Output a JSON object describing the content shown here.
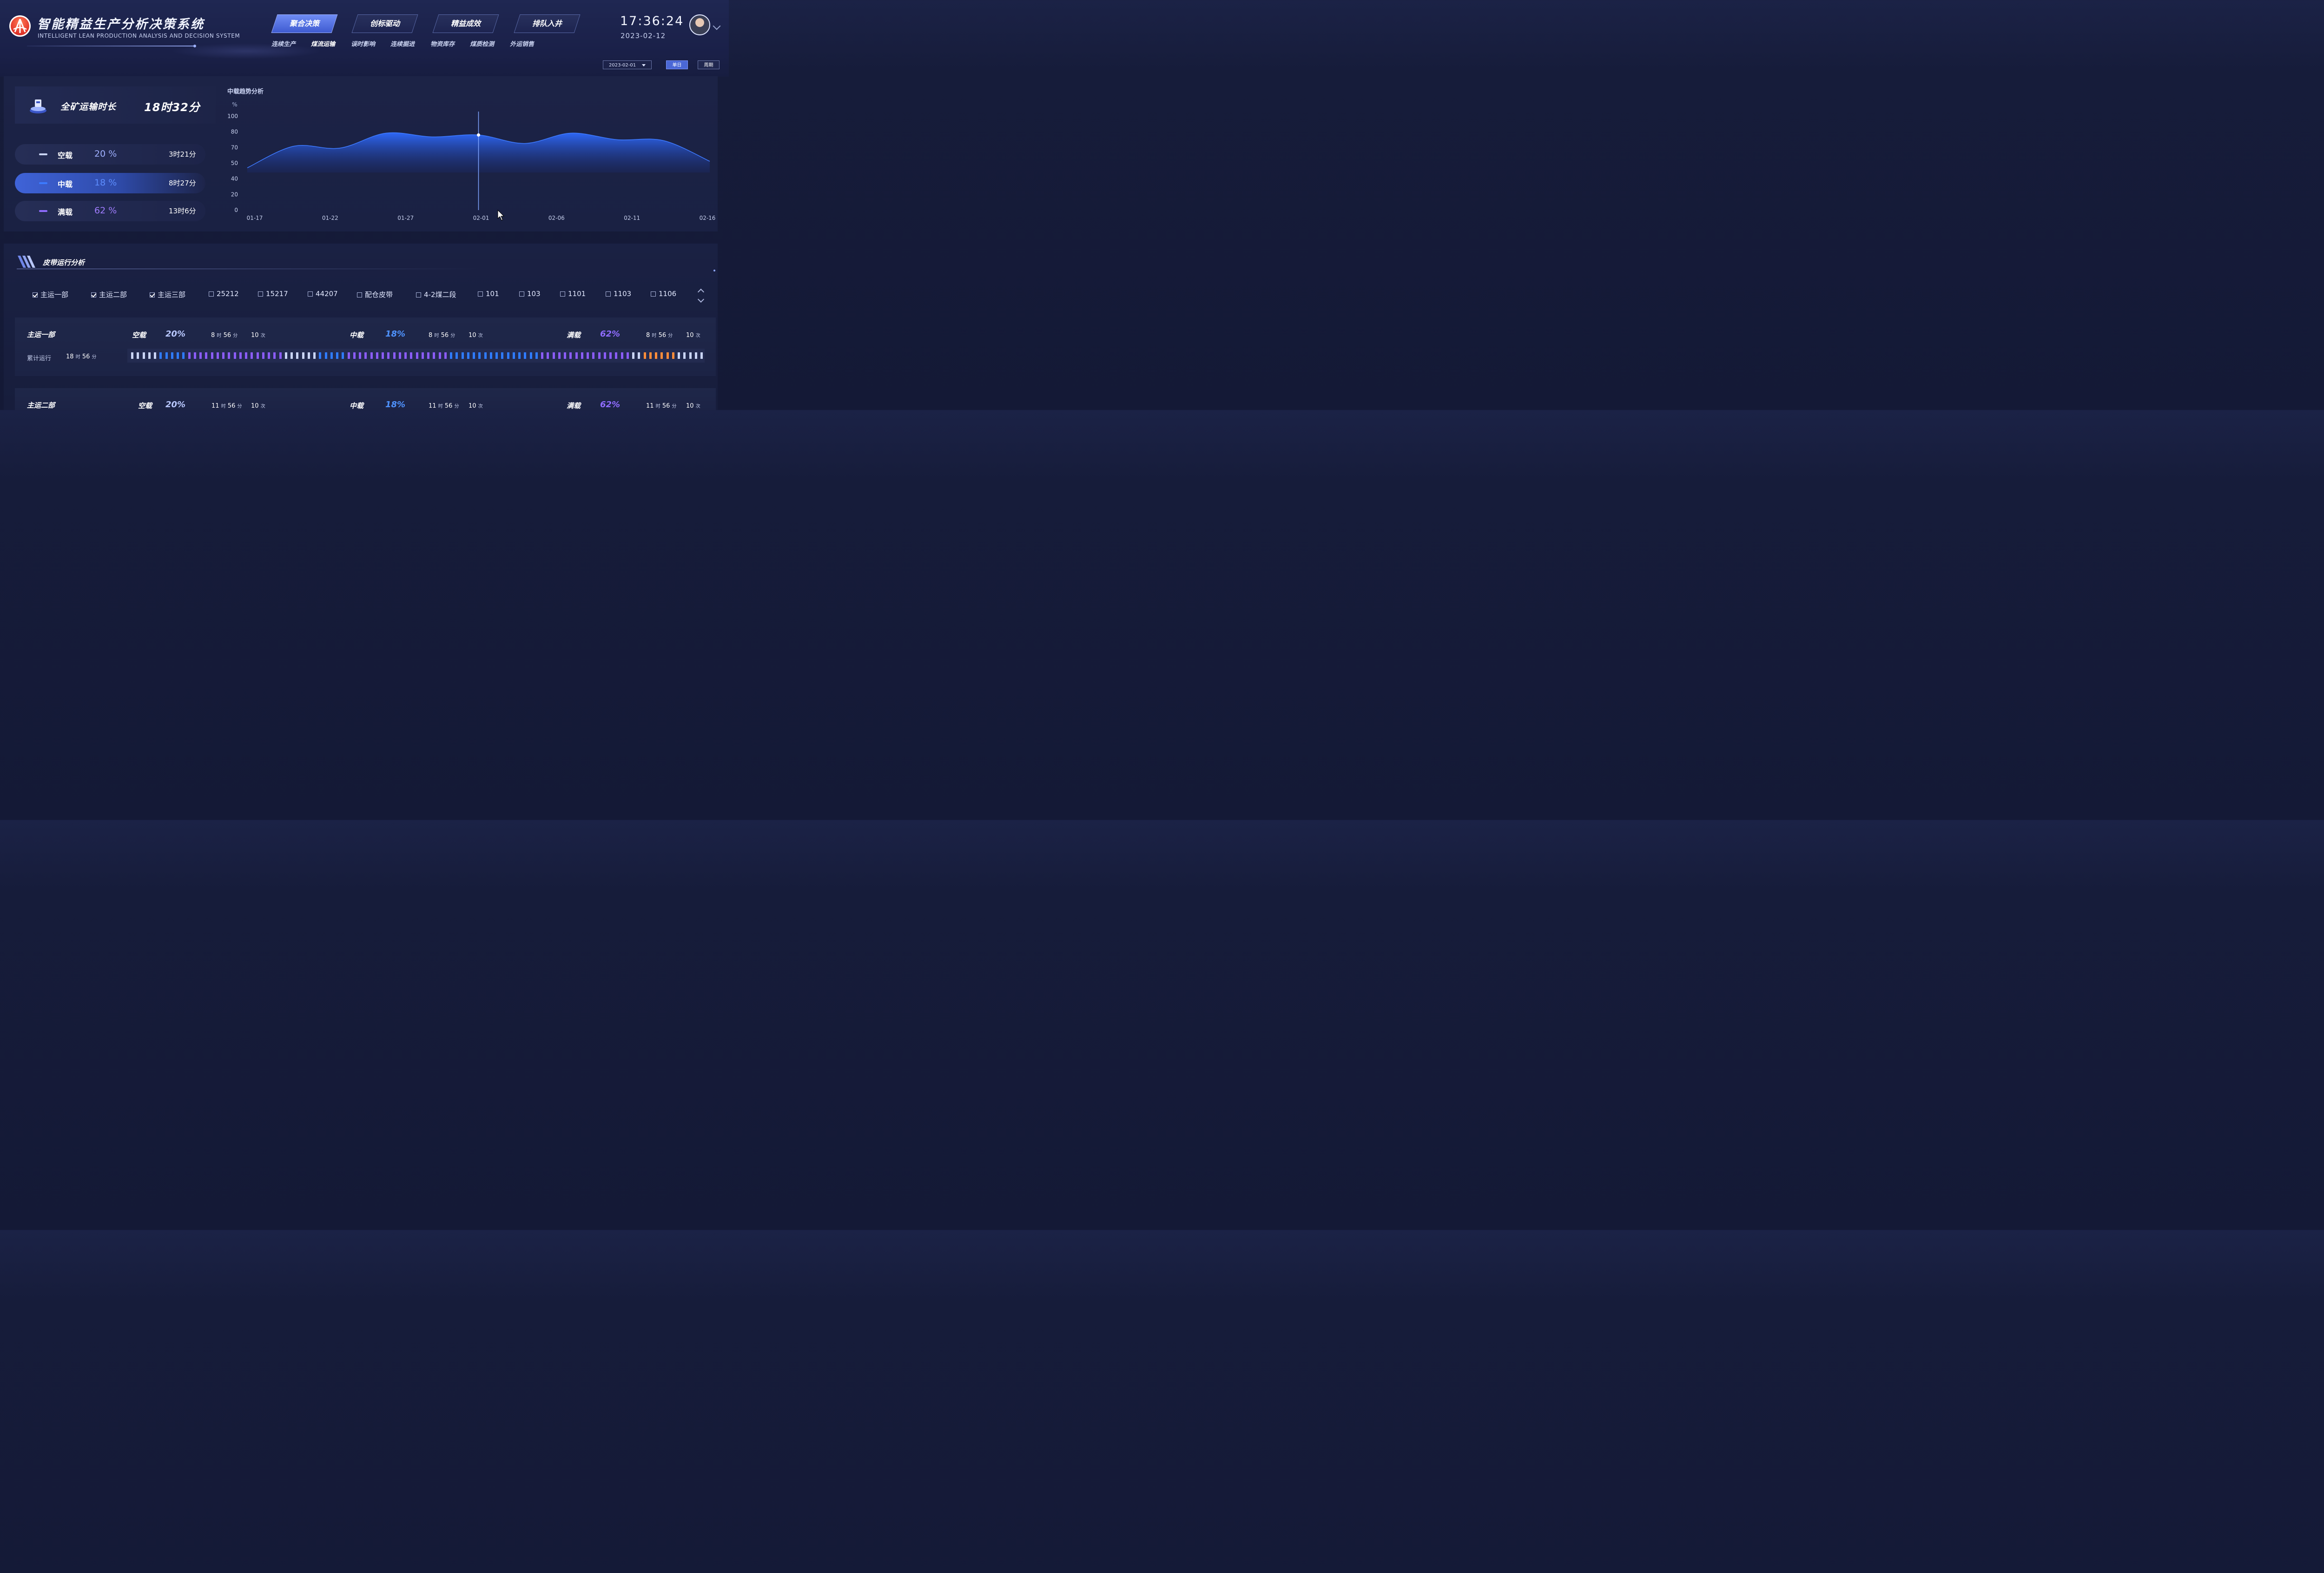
{
  "header": {
    "title_cn": "智能精益生产分析决策系统",
    "title_en": "INTELLIGENT LEAN PRODUCTION ANALYSIS AND DECISION SYSTEM",
    "tabs": [
      {
        "label": "聚合决策",
        "active": true
      },
      {
        "label": "创标驱动",
        "active": false
      },
      {
        "label": "精益成效",
        "active": false
      },
      {
        "label": "排队入井",
        "active": false
      }
    ],
    "subnav": [
      {
        "label": "连续生产",
        "active": false
      },
      {
        "label": "煤流运输",
        "active": true
      },
      {
        "label": "误时影响",
        "active": false
      },
      {
        "label": "连续掘进",
        "active": false
      },
      {
        "label": "物资库存",
        "active": false
      },
      {
        "label": "煤质检测",
        "active": false
      },
      {
        "label": "外运销售",
        "active": false
      }
    ],
    "time": "17:36:24",
    "date": "2023-02-12",
    "date_select": "2023-02-01",
    "btn_single": "单日",
    "btn_period": "周期"
  },
  "summary": {
    "label": "全矿运输时长",
    "value": "18时32分"
  },
  "loads": [
    {
      "name": "空载",
      "pct": "20 %",
      "time": "3时21分",
      "color": "#9fb0ff",
      "active": false
    },
    {
      "name": "中载",
      "pct": "18 %",
      "time": "8时27分",
      "color": "#3c7bff",
      "active": true
    },
    {
      "name": "满载",
      "pct": "62 %",
      "time": "13时6分",
      "color": "#8f6cff",
      "active": false
    }
  ],
  "chart_data": {
    "type": "area",
    "title": "中载趋势分析",
    "ylabel": "%",
    "ylim": [
      0,
      100
    ],
    "yticks": [
      "100",
      "80",
      "70",
      "50",
      "40",
      "20",
      "0"
    ],
    "xticks": [
      "01-17",
      "01-22",
      "01-27",
      "02-01",
      "02-06",
      "02-11",
      "02-16"
    ],
    "x": [
      "01-17",
      "01-20",
      "01-23",
      "01-26",
      "01-29",
      "02-01",
      "02-04",
      "02-07",
      "02-10",
      "02-13",
      "02-16"
    ],
    "values": [
      45,
      68,
      66,
      82,
      78,
      80,
      71,
      82,
      75,
      74,
      52
    ],
    "highlight": {
      "x": "02-01",
      "value": 80
    },
    "color": "#2f6bff"
  },
  "belt_section": {
    "title": "皮带运行分析",
    "filters": [
      {
        "label": "主运一部",
        "checked": true
      },
      {
        "label": "主运二部",
        "checked": true
      },
      {
        "label": "主运三部",
        "checked": true
      },
      {
        "label": "25212",
        "checked": false
      },
      {
        "label": "15217",
        "checked": false
      },
      {
        "label": "44207",
        "checked": false
      },
      {
        "label": "配仓皮带",
        "checked": false
      },
      {
        "label": "4-2煤二段",
        "checked": false
      },
      {
        "label": "101",
        "checked": false
      },
      {
        "label": "103",
        "checked": false
      },
      {
        "label": "1101",
        "checked": false
      },
      {
        "label": "1103",
        "checked": false
      },
      {
        "label": "1106",
        "checked": false
      }
    ],
    "belts": [
      {
        "name": "主运一部",
        "empty": {
          "label": "空载",
          "pct": "20%",
          "h": "8",
          "m": "56",
          "count": "10"
        },
        "mid": {
          "label": "中载",
          "pct": "18%",
          "h": "8",
          "m": "56",
          "count": "10"
        },
        "full": {
          "label": "满载",
          "pct": "62%",
          "h": "8",
          "m": "56",
          "count": "10"
        },
        "cum_label": "累计运行",
        "cum_h": "18",
        "cum_m": "56"
      },
      {
        "name": "主运二部",
        "empty": {
          "label": "空载",
          "pct": "20%",
          "h": "11",
          "m": "56",
          "count": "10"
        },
        "mid": {
          "label": "中载",
          "pct": "18%",
          "h": "11",
          "m": "56",
          "count": "10"
        },
        "full": {
          "label": "满载",
          "pct": "62%",
          "h": "11",
          "m": "56",
          "count": "10"
        }
      }
    ],
    "unit_hour": "时",
    "unit_min": "分",
    "unit_count": "次",
    "colors": {
      "empty": "#c9d4f5",
      "mid": "#2f7bff",
      "full": "#8a5cf6",
      "warn": "#ff8c3a"
    }
  }
}
